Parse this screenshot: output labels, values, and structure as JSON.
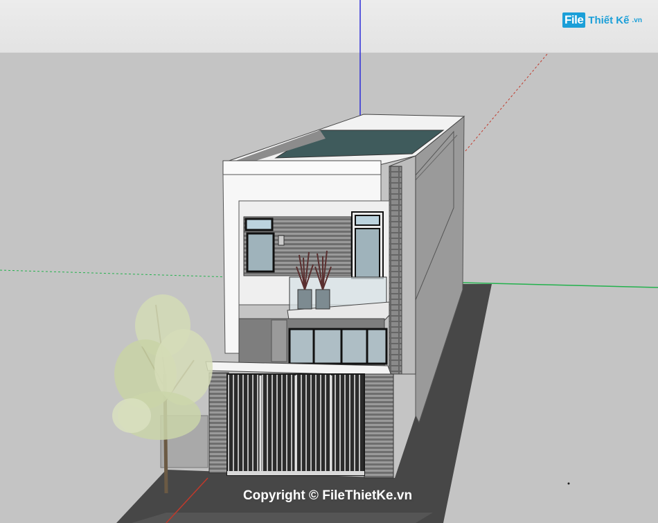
{
  "watermark": {
    "logo_mark": "File",
    "logo_name": "Thiết Kế",
    "logo_tld": ".vn",
    "copyright": "Copyright © FileThietKe.vn"
  },
  "colors": {
    "sky": "#e8e8e8",
    "ground": "#c4c4c4",
    "road": "#4a4a4a",
    "axis_blue": "#2b2bd8",
    "axis_green": "#22b14c",
    "axis_red": "#c0392b",
    "wall_white": "#f7f7f7",
    "wall_side": "#8f8f8f",
    "roof_glass": "#3f5b5c",
    "brand": "#1b9fd8"
  }
}
